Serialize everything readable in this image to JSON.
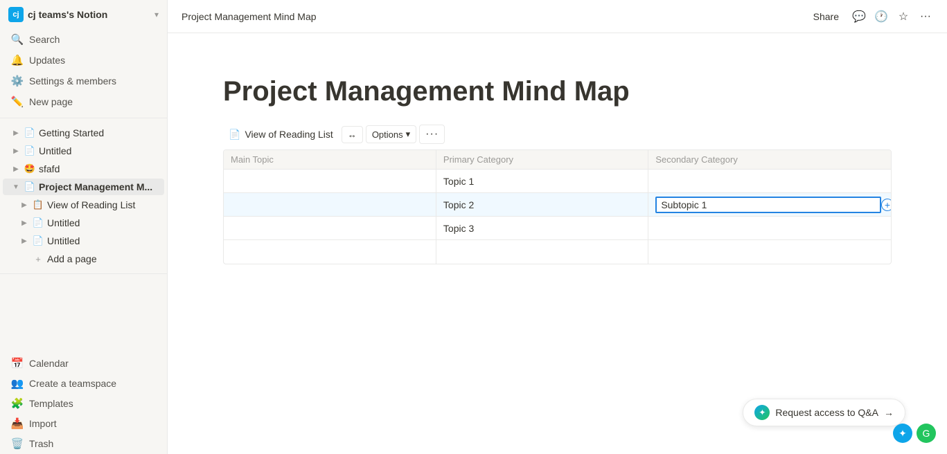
{
  "workspace": {
    "avatar_text": "cj",
    "name": "cj teams's Notion",
    "chevron": "▾"
  },
  "sidebar": {
    "actions": [
      {
        "id": "search",
        "label": "Search",
        "icon": "🔍"
      },
      {
        "id": "updates",
        "label": "Updates",
        "icon": "🔔"
      },
      {
        "id": "settings",
        "label": "Settings & members",
        "icon": "⚙️"
      },
      {
        "id": "new-page",
        "label": "New page",
        "icon": "✏️"
      }
    ],
    "items": [
      {
        "id": "getting-started",
        "label": "Getting Started",
        "icon": "📄",
        "indent": 0,
        "arrow": "▶"
      },
      {
        "id": "untitled-1",
        "label": "Untitled",
        "icon": "📄",
        "indent": 0,
        "arrow": "▶"
      },
      {
        "id": "sfafd",
        "label": "sfafd",
        "icon": "🤩",
        "indent": 0,
        "arrow": "▶"
      },
      {
        "id": "project-mgmt",
        "label": "Project Management M...",
        "icon": "📄",
        "indent": 0,
        "arrow": "▼",
        "active": true
      },
      {
        "id": "view-reading-list",
        "label": "View of Reading List",
        "icon": "📋",
        "indent": 1,
        "arrow": "▶"
      },
      {
        "id": "untitled-2",
        "label": "Untitled",
        "icon": "📄",
        "indent": 1,
        "arrow": "▶"
      },
      {
        "id": "untitled-3",
        "label": "Untitled",
        "icon": "📄",
        "indent": 1,
        "arrow": "▶"
      },
      {
        "id": "add-page",
        "label": "Add a page",
        "icon": "+",
        "indent": 1,
        "arrow": ""
      }
    ],
    "bottom_items": [
      {
        "id": "calendar",
        "label": "Calendar",
        "icon": "📅"
      },
      {
        "id": "create-teamspace",
        "label": "Create a teamspace",
        "icon": "👥"
      },
      {
        "id": "templates",
        "label": "Templates",
        "icon": "🧩"
      },
      {
        "id": "import",
        "label": "Import",
        "icon": "📥"
      },
      {
        "id": "trash",
        "label": "Trash",
        "icon": "🗑️"
      }
    ]
  },
  "topbar": {
    "page_title": "Project Management Mind Map",
    "share_label": "Share",
    "comment_icon": "💬",
    "history_icon": "🕐",
    "favorite_icon": "☆",
    "more_icon": "···"
  },
  "page": {
    "heading": "Project Management Mind Map",
    "view": {
      "icon": "📄",
      "title": "View of Reading List",
      "expand_icon": "↔",
      "options_label": "Options",
      "options_chevron": "▾",
      "more_icon": "···"
    },
    "table": {
      "columns": [
        "Main Topic",
        "Primary Category",
        "Secondary Category"
      ],
      "col_widths": [
        "140px",
        "140px",
        "160px"
      ],
      "rows": [
        {
          "id": 1,
          "cells": [
            "",
            "Topic 1",
            ""
          ],
          "highlighted": false
        },
        {
          "id": 2,
          "cells": [
            "",
            "Topic 2",
            "Subtopic 1"
          ],
          "highlighted": true
        },
        {
          "id": 3,
          "cells": [
            "",
            "Topic 3",
            ""
          ],
          "highlighted": false
        },
        {
          "id": 4,
          "cells": [
            "",
            "",
            ""
          ],
          "highlighted": false
        }
      ]
    }
  },
  "request_access": {
    "label": "Request access to Q&A",
    "arrow": "→"
  }
}
